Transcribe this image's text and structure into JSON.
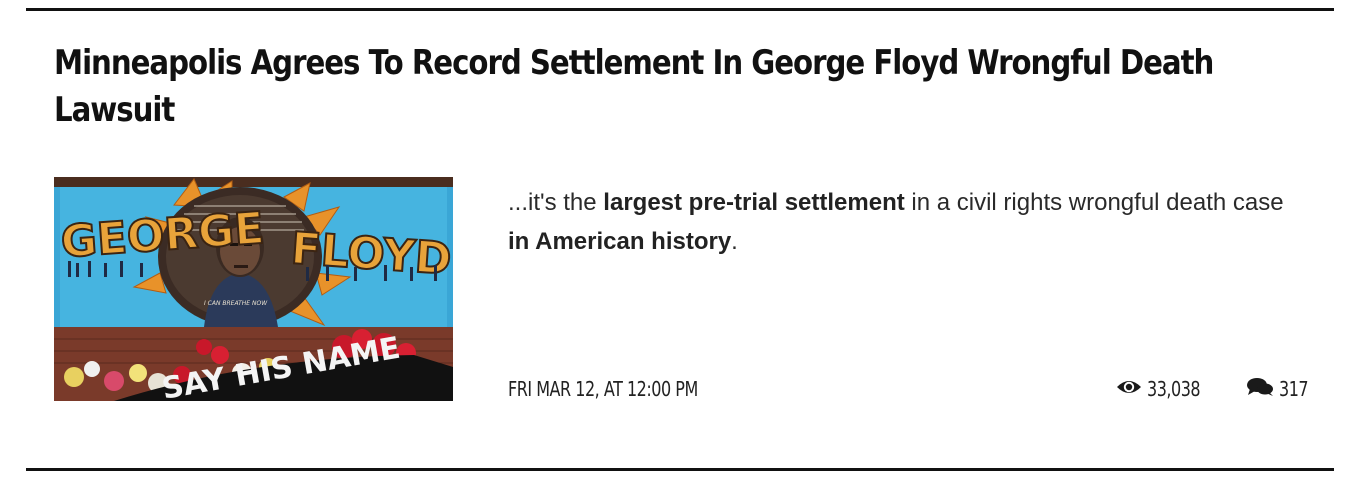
{
  "article": {
    "headline": "Minneapolis Agrees To Record Settlement In George Floyd Wrongful Death Lawsuit",
    "excerpt": {
      "part1": "...it's the ",
      "bold1": "largest pre-trial settlement",
      "part2": " in a civil rights wrongful death case ",
      "bold2": "in American history",
      "part3": "."
    },
    "date": "FRI MAR 12, AT 12:00 PM",
    "views": "33,038",
    "comments": "317",
    "image": {
      "mural_text_left": "GEORGE",
      "mural_text_right": "FLOYD",
      "banner_text": "SAY HIS NAME",
      "mural_caption": "I CAN BREATHE NOW"
    }
  },
  "icons": {
    "views": "eye-icon",
    "comments": "comment-bubbles-icon"
  },
  "colors": {
    "text": "#111111",
    "rule": "#111111",
    "mural_sky": "#3aa6d6",
    "mural_orange": "#e8922a",
    "flowers_red": "#c8182a"
  }
}
